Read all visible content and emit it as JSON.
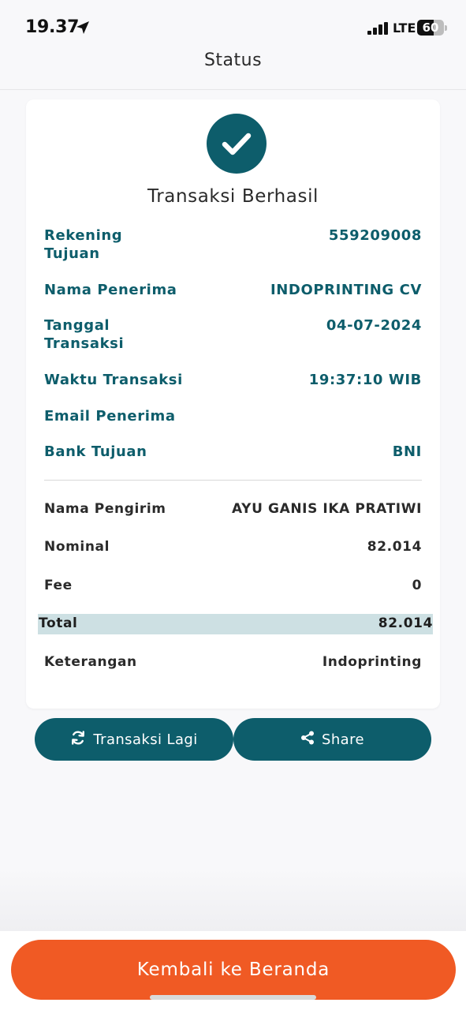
{
  "status_bar": {
    "time": "19.37",
    "network": "LTE",
    "battery": "60"
  },
  "header": {
    "title": "Status"
  },
  "receipt": {
    "title": "Transaksi Berhasil",
    "details": [
      {
        "label": "Rekening\nTujuan",
        "value": "559209008"
      },
      {
        "label": "Nama Penerima",
        "value": "INDOPRINTING CV"
      },
      {
        "label": "Tanggal\nTransaksi",
        "value": "04-07-2024"
      },
      {
        "label": "Waktu Transaksi",
        "value": "19:37:10 WIB"
      },
      {
        "label": "Email Penerima",
        "value": ""
      },
      {
        "label": "Bank Tujuan",
        "value": "BNI"
      }
    ],
    "summary": [
      {
        "label": "Nama Pengirim",
        "value": "AYU GANIS IKA PRATIWI"
      },
      {
        "label": "Nominal",
        "value": "82.014"
      },
      {
        "label": "Fee",
        "value": "0"
      }
    ],
    "total": {
      "label": "Total",
      "value": "82.014"
    },
    "note": {
      "label": "Keterangan",
      "value": "Indoprinting"
    }
  },
  "actions": {
    "again_label": "Transaksi Lagi",
    "share_label": "Share"
  },
  "footer": {
    "home_label": "Kembali ke Beranda"
  },
  "colors": {
    "primary": "#0d5d6b",
    "accent": "#f05a24",
    "total_highlight": "#cde0e3"
  },
  "icons": {
    "success": "check-icon",
    "again": "refresh-icon",
    "share": "share-icon",
    "location": "location-arrow-icon"
  }
}
